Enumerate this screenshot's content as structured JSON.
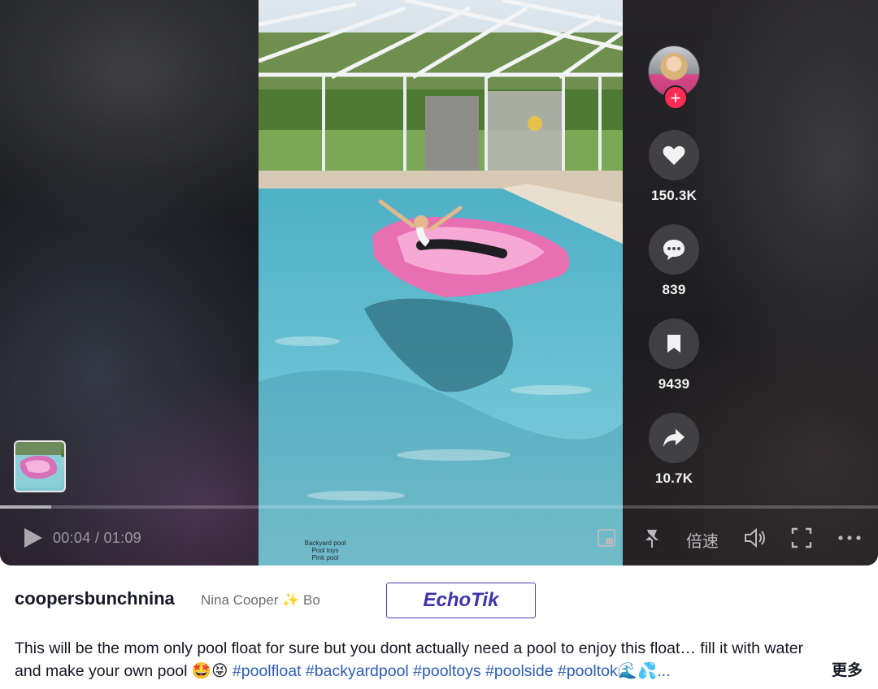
{
  "video": {
    "overlay_lines": [
      "Backyard pool",
      "Pool toys",
      "Pink pool"
    ]
  },
  "sidebar": {
    "follow_label": "+",
    "actions": [
      {
        "icon": "heart-icon",
        "count": "150.3K"
      },
      {
        "icon": "comment-icon",
        "count": "839"
      },
      {
        "icon": "bookmark-icon",
        "count": "9439"
      },
      {
        "icon": "share-icon",
        "count": "10.7K"
      }
    ]
  },
  "player": {
    "current_time": "00:04",
    "duration": "01:09",
    "time_display": "00:04 / 01:09",
    "progress": 0.058,
    "speed_label": "倍速"
  },
  "info": {
    "username": "coopersbunchnina",
    "nickname": "Nina Cooper ✨ Bo",
    "watermark": "EchoTik",
    "description_text": "This will be the mom only pool float for sure but you dont actually need a pool to enjoy this float… fill it with water and make your own pool 🤩😝 ",
    "hashtags": [
      "#poolfloat",
      "#backyardpool",
      "#pooltoys",
      "#poolside",
      "#pooltok🌊💦..."
    ],
    "more_label": "更多"
  },
  "colors": {
    "accent_red": "#fe2c55",
    "hashtag_blue": "#2b5db5",
    "watermark_purple": "#3f34a8"
  }
}
